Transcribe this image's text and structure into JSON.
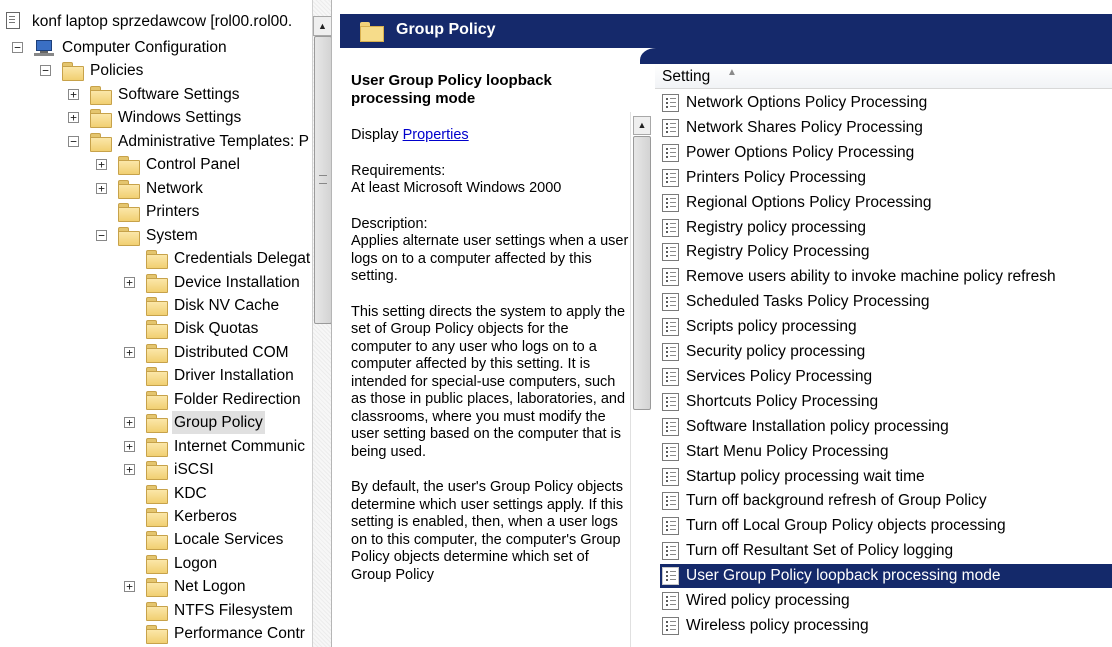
{
  "tree": {
    "window_title": "konf laptop sprzedawcow [rol00.rol00.",
    "items": [
      {
        "label": "Computer Configuration",
        "expander": "−"
      },
      {
        "label": "Policies",
        "expander": "−"
      },
      {
        "label": "Software Settings",
        "expander": "+"
      },
      {
        "label": "Windows Settings",
        "expander": "+"
      },
      {
        "label": "Administrative Templates: P",
        "expander": "−"
      },
      {
        "label": "Control Panel",
        "expander": "+"
      },
      {
        "label": "Network",
        "expander": "+"
      },
      {
        "label": "Printers",
        "expander": ""
      },
      {
        "label": "System",
        "expander": "−"
      },
      {
        "label": "Credentials Delegat",
        "expander": ""
      },
      {
        "label": "Device Installation",
        "expander": "+"
      },
      {
        "label": "Disk NV Cache",
        "expander": ""
      },
      {
        "label": "Disk Quotas",
        "expander": ""
      },
      {
        "label": "Distributed COM",
        "expander": "+"
      },
      {
        "label": "Driver Installation",
        "expander": ""
      },
      {
        "label": "Folder Redirection",
        "expander": ""
      },
      {
        "label": "Group Policy",
        "expander": "+"
      },
      {
        "label": "Internet Communic",
        "expander": "+"
      },
      {
        "label": "iSCSI",
        "expander": "+"
      },
      {
        "label": "KDC",
        "expander": ""
      },
      {
        "label": "Kerberos",
        "expander": ""
      },
      {
        "label": "Locale Services",
        "expander": ""
      },
      {
        "label": "Logon",
        "expander": ""
      },
      {
        "label": "Net Logon",
        "expander": "+"
      },
      {
        "label": "NTFS Filesystem",
        "expander": ""
      },
      {
        "label": "Performance Contr",
        "expander": ""
      }
    ],
    "selected": "Group Policy",
    "scroll_up": "▲"
  },
  "header": {
    "title": "Group Policy"
  },
  "description": {
    "policy_title": "User Group Policy loopback processing mode",
    "display_prefix": "Display ",
    "display_link": "Properties",
    "requirements_label": "Requirements:",
    "requirements_value": "At least Microsoft Windows 2000",
    "description_label": "Description:",
    "description_p1": "Applies alternate user settings when a user logs on to a computer affected by this setting.",
    "description_p2": "This setting directs the system to apply the set of Group Policy objects for the computer to any user who logs on to a computer affected by this setting. It is intended for special-use computers, such as those in public places, laboratories, and classrooms, where you must modify the user setting based on the computer that is being used.",
    "description_p3": "By default, the user's Group Policy objects determine which user settings apply. If this setting is enabled, then, when a user logs on to this computer, the computer's Group Policy objects determine which set of Group Policy",
    "scroll_up": "▲"
  },
  "settings": {
    "column_header": "Setting",
    "sort_indicator": "▲",
    "rows": [
      "Network Options Policy Processing",
      "Network Shares Policy Processing",
      "Power Options Policy Processing",
      "Printers Policy Processing",
      "Regional Options Policy Processing",
      "Registry policy processing",
      "Registry Policy Processing",
      "Remove users ability to invoke machine policy refresh",
      "Scheduled Tasks Policy Processing",
      "Scripts policy processing",
      "Security policy processing",
      "Services Policy Processing",
      "Shortcuts Policy Processing",
      "Software Installation policy processing",
      "Start Menu Policy Processing",
      "Startup policy processing wait time",
      "Turn off background refresh of Group Policy",
      "Turn off Local Group Policy objects processing",
      "Turn off Resultant Set of Policy logging",
      "User Group Policy loopback processing mode",
      "Wired policy processing",
      "Wireless policy processing"
    ],
    "selected": "User Group Policy loopback processing mode"
  },
  "colors": {
    "header_bg": "#15296b",
    "selection_bg": "#14296a"
  }
}
